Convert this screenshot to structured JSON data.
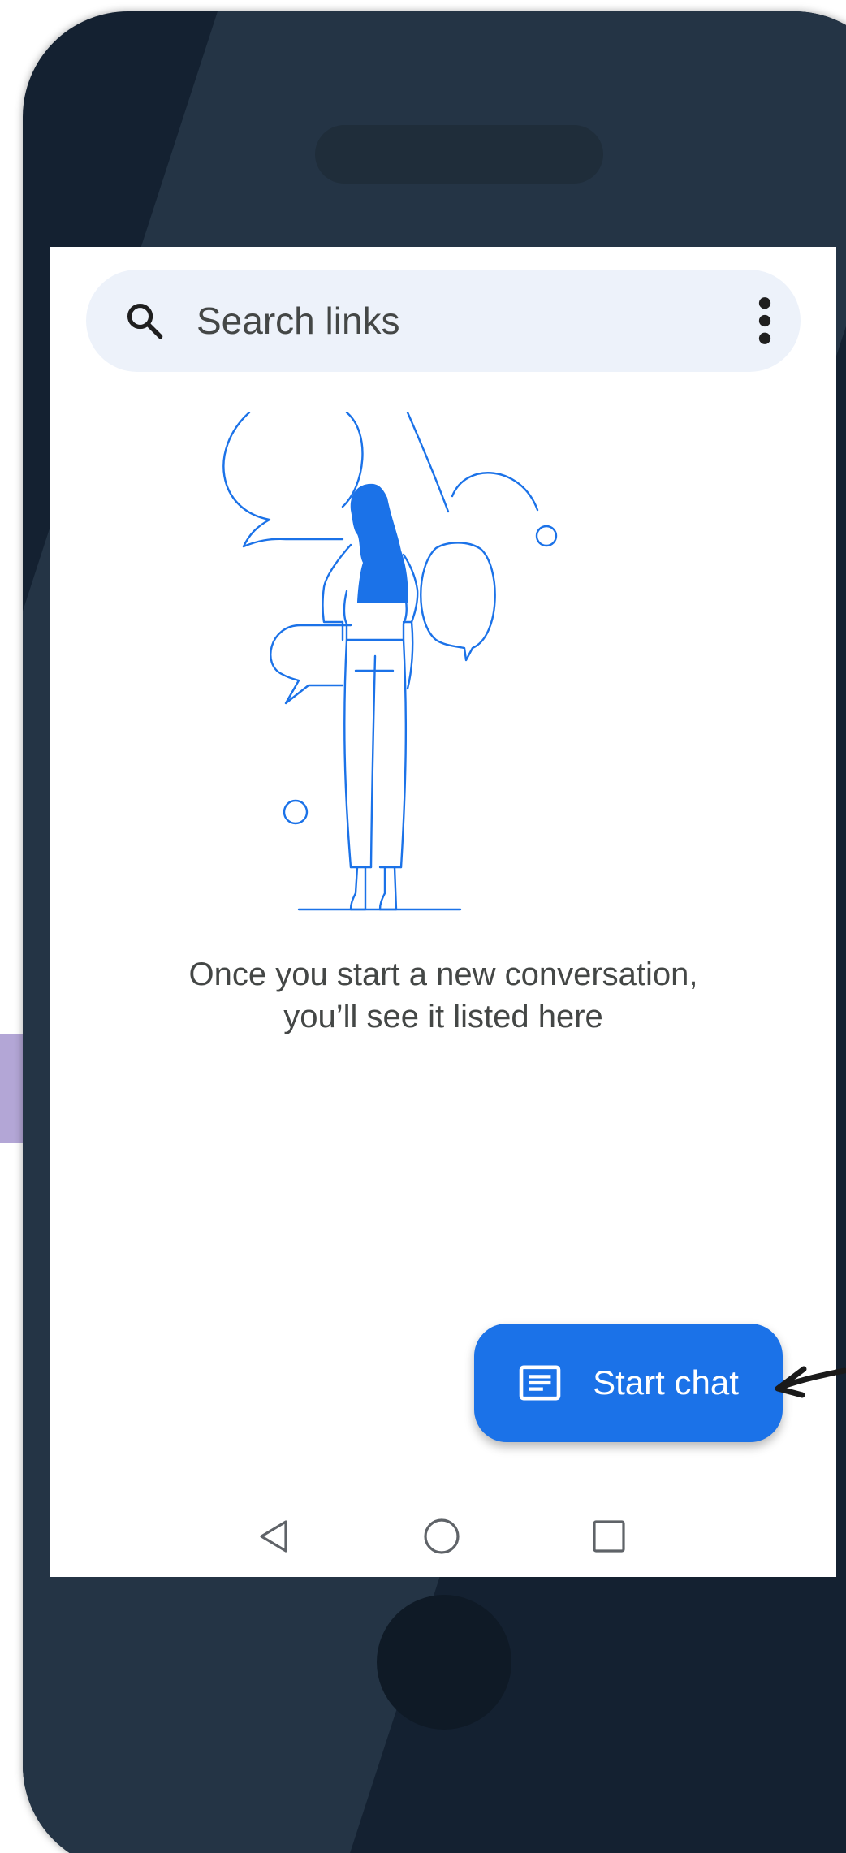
{
  "search": {
    "placeholder": "Search links",
    "icon": "search-icon",
    "menu_icon": "more-vertical-icon"
  },
  "empty_state": {
    "message": "Once you start a new conversation, you’ll see it listed here",
    "illustration": "person-with-speech-bubbles-illustration"
  },
  "fab": {
    "label": "Start chat",
    "icon": "message-icon"
  },
  "nav_bar": {
    "back_icon": "triangle-back-icon",
    "home_icon": "circle-home-icon",
    "recents_icon": "square-recents-icon"
  },
  "colors": {
    "accent": "#1b72e8",
    "search_background": "#edf2fa",
    "device_body": "#142131",
    "text": "#444746",
    "illustration_line": "#1b72e8"
  }
}
